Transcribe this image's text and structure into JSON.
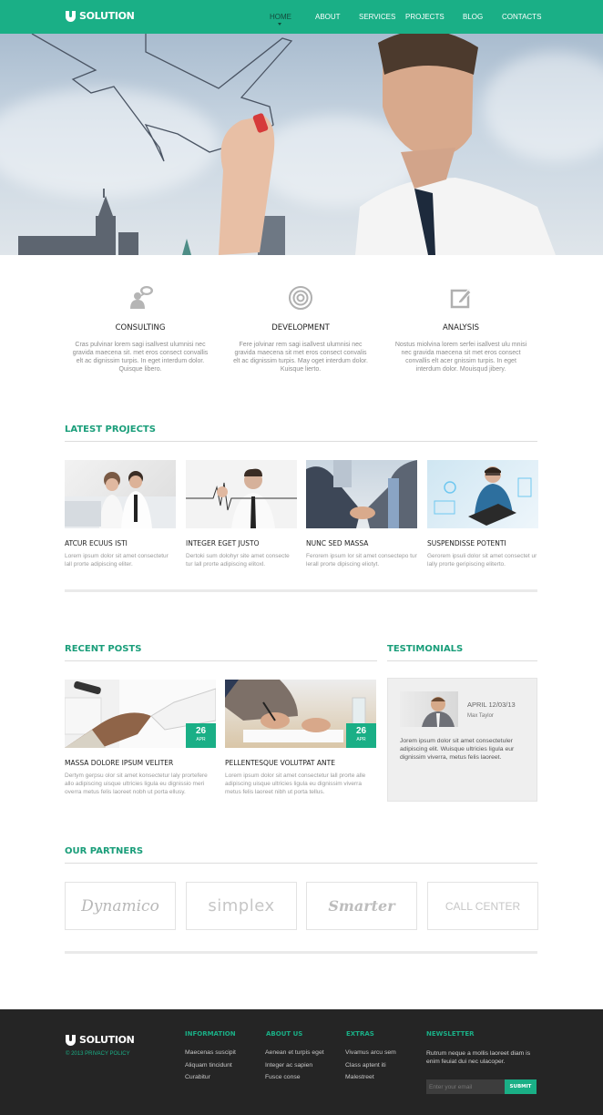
{
  "brand": {
    "name": "SOLUTION",
    "accent": "#1aaf86"
  },
  "nav": {
    "items": [
      {
        "label": "HOME",
        "active": true
      },
      {
        "label": "ABOUT"
      },
      {
        "label": "SERVICES"
      },
      {
        "label": "PROJECTS"
      },
      {
        "label": "BLOG"
      },
      {
        "label": "CONTACTS"
      }
    ]
  },
  "hero": {
    "image": "businessman-drawing-airplane"
  },
  "features": [
    {
      "icon": "consulting-person-speech-icon",
      "title": "CONSULTING",
      "text": "Cras pulvinar lorem sagi isallvest ulumnisi nec gravida maecena sit. met eros consect convallis elt ac dignissim turpis. In eget interdum dolor. Quisque libero."
    },
    {
      "icon": "target-icon",
      "title": "DEVELOPMENT",
      "text": "Fere jolvinar rem sagi isallvest ulumnisi nec gravida maecena sit met eros consect convalis elt ac dignissim turpis. May oget interdum dolor. Kuisque lierto."
    },
    {
      "icon": "edit-note-icon",
      "title": "ANALYSIS",
      "text": "Nostus miolvina lorem serfei isallvest ulu mnisi nec gravida maecena sit met eros consect convallis elt acer gnissim turpis. In eget interdum dolor. Mouisqud jibery."
    }
  ],
  "latest_projects": {
    "title": "LATEST PROJECTS",
    "items": [
      {
        "title": "ATCUR ECUUS ISTI",
        "text": "Lorem ipsum dolor sit amet consectetur lall prorte adipiscing eliter."
      },
      {
        "title": "INTEGER EGET JUSTO",
        "text": "Dertoki sum dolohyr site amet consecte tur lall prorte adipiscing elitoxl."
      },
      {
        "title": "NUNC SED MASSA",
        "text": "Ferorem ipsum lor sit amet consectepo tur lerall prorte dipiscing eliotyt."
      },
      {
        "title": "SUSPENDISSE POTENTI",
        "text": "Gerorem ipsuli dolor sit amet consectet ur lally prorte geripiscing eliterto."
      }
    ]
  },
  "recent_posts": {
    "title": "RECENT POSTS",
    "items": [
      {
        "day": "26",
        "month": "APR",
        "title": "MASSA DOLORE IPSUM VELITER",
        "text": "Dertym gerpsu olor sit amet konsectetur laly prortefere allo adipiscing uisque ultricies ligula eu dignissio meri overra metus felis laoreet nobh ut porta ellusy."
      },
      {
        "day": "26",
        "month": "APR",
        "title": "PELLENTESQUE VOLUTPAT ANTE",
        "text": "Lorem ipsum dolor sit amet consectetur lall prorte alle adipiscing uisque ultricies ligula eu dignissim viverra metus felis laoreet nibh ut porta tellus."
      }
    ]
  },
  "testimonials": {
    "title": "TESTIMONIALS",
    "date": "APRIL 12/03/13",
    "author": "Max Taylor",
    "text": "Jorem ipsum dolor sit amet consectetuler adipiscing elit. Wuisque ultricies ligula eur dignissim viverra, metus felis laoreet."
  },
  "partners": {
    "title": "OUR PARTNERS",
    "items": [
      "Dynamico",
      "simplex",
      "Smarter",
      "CALL CENTER"
    ]
  },
  "footer": {
    "brand": "SOLUTION",
    "copyright": "© 2013 PRIVACY POLICY",
    "columns": [
      {
        "title": "INFORMATION",
        "links": [
          "Maecenas suscipit",
          "Aliquam tincidunt",
          "Curabitur"
        ]
      },
      {
        "title": "ABOUT US",
        "links": [
          "Aenean et turpis eget",
          "Integer ac sapien",
          "Fusce conse"
        ]
      },
      {
        "title": "EXTRAS",
        "links": [
          "Vivamus arcu sem",
          "Class aptent iti",
          "Malestreet"
        ]
      }
    ],
    "newsletter": {
      "title": "NEWSLETTER",
      "text": "Rutrum neque a mollis laoreet diam is enim feuiat dui nec ulacoper.",
      "placeholder": "Enter your email",
      "button": "SUBMIT"
    }
  }
}
